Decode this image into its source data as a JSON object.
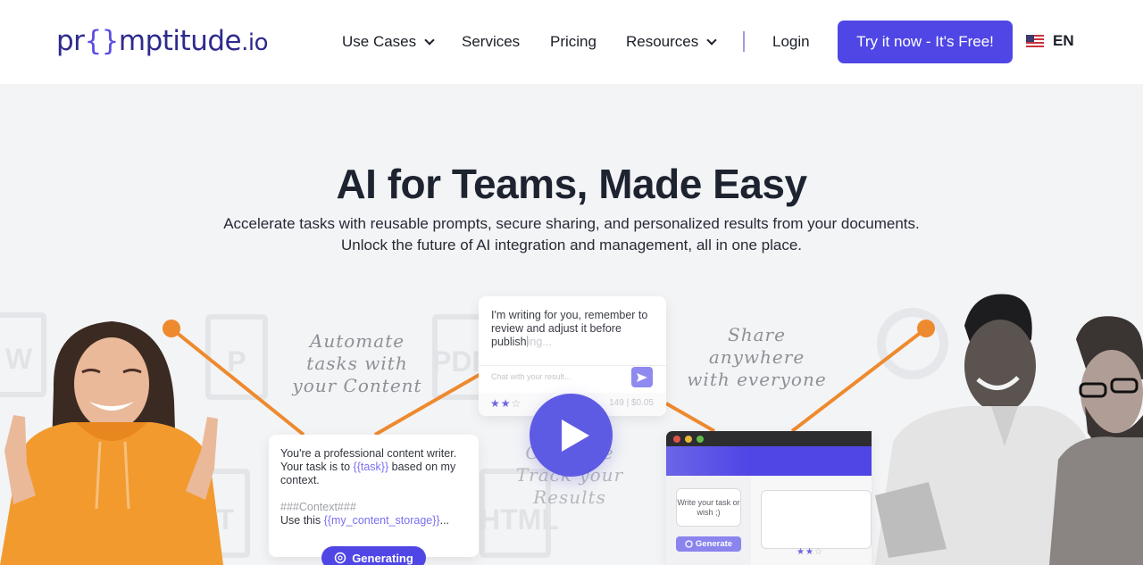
{
  "brand": {
    "logo_prefix": "pr",
    "logo_brace": "{}",
    "logo_suffix": "mptitude",
    "logo_tld": ".io",
    "accent_color": "#4f46e5",
    "highlight_color": "#ee8a2e"
  },
  "nav": {
    "items": [
      {
        "label": "Use Cases",
        "has_dropdown": true
      },
      {
        "label": "Services",
        "has_dropdown": false
      },
      {
        "label": "Pricing",
        "has_dropdown": false
      },
      {
        "label": "Resources",
        "has_dropdown": true
      }
    ],
    "login_label": "Login",
    "cta_label": "Try it now - It's Free!",
    "language": {
      "code": "EN",
      "flag_icon": "us-flag-icon"
    }
  },
  "hero": {
    "title": "AI for Teams, Made Easy",
    "subtitle_line1": "Accelerate tasks with reusable prompts, secure sharing, and personalized results from your documents.",
    "subtitle_line2": "Unlock the future of AI integration and management, all in one place."
  },
  "illustration": {
    "callouts": {
      "automate": [
        "Automate",
        "tasks with",
        "your Content"
      ],
      "share": [
        "Share",
        "anywhere",
        "with everyone"
      ],
      "optimize": [
        "Optimize",
        "Track your",
        "Results"
      ]
    },
    "doc_icons": [
      "W",
      "P",
      "PDF",
      "T",
      "HTML"
    ],
    "chat_card": {
      "text": "I'm writing for you, remember to review and adjust it before publish",
      "text_fade": "ing...",
      "input_placeholder": "Chat with your result...",
      "rating_filled": 2,
      "rating_total": 3,
      "stars_filled": "★★",
      "stars_empty": "☆",
      "cost": "149 | $0.05"
    },
    "prompt_card": {
      "line1": "You're a professional content writer. Your task is to ",
      "var_task": "{{task}}",
      "line2": " based on my context.",
      "context_heading": "###Context###",
      "use_this": "Use this ",
      "var_storage": "{{my_content_storage}}",
      "ellipsis": "...",
      "generating_label": "Generating"
    },
    "app_window": {
      "task_placeholder": "Write your task or wish ;)",
      "generate_label": "Generate",
      "rating_filled": 2,
      "rating_total": 3,
      "stars_filled": "★★",
      "stars_empty": "☆"
    },
    "play_button_label": "Play video"
  }
}
